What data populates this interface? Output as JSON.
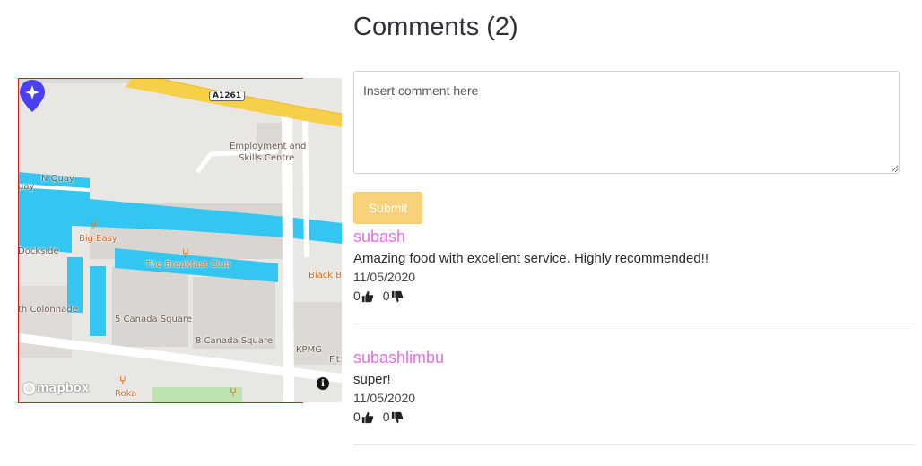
{
  "page": {
    "heading": "Comments (2)"
  },
  "map": {
    "road_shield": "A1261",
    "attribution_logo": "mapbox",
    "info_icon": "info-icon",
    "labels": {
      "employment": "Employment and",
      "employment2": "Skills Centre",
      "n_quay": "N Quay",
      "quay": "uay",
      "dockside": "Dockside",
      "colonnade": "th Colonnade",
      "five_canada": "5 Canada Square",
      "eight_canada": "8 Canada Square",
      "kpmg": "KPMG",
      "fit": "Fit",
      "black_b": "Black B",
      "big_easy": "Big Easy",
      "breakfast_club": "The Breakfast Club",
      "roka": "Roka"
    },
    "colors": {
      "water": "#33c6f0",
      "motorway": "#f7d04a",
      "pin": "#4a3ff2",
      "poi": "#d9671a"
    }
  },
  "comment_form": {
    "placeholder": "Insert comment here",
    "value": "",
    "submit_label": "Submit"
  },
  "comments": [
    {
      "author": "subash",
      "text": "Amazing food with excellent service. Highly recommended!!",
      "date": "11/05/2020",
      "likes": "0",
      "dislikes": "0"
    },
    {
      "author": "subashlimbu",
      "text": "super!",
      "date": "11/05/2020",
      "likes": "0",
      "dislikes": "0"
    }
  ]
}
